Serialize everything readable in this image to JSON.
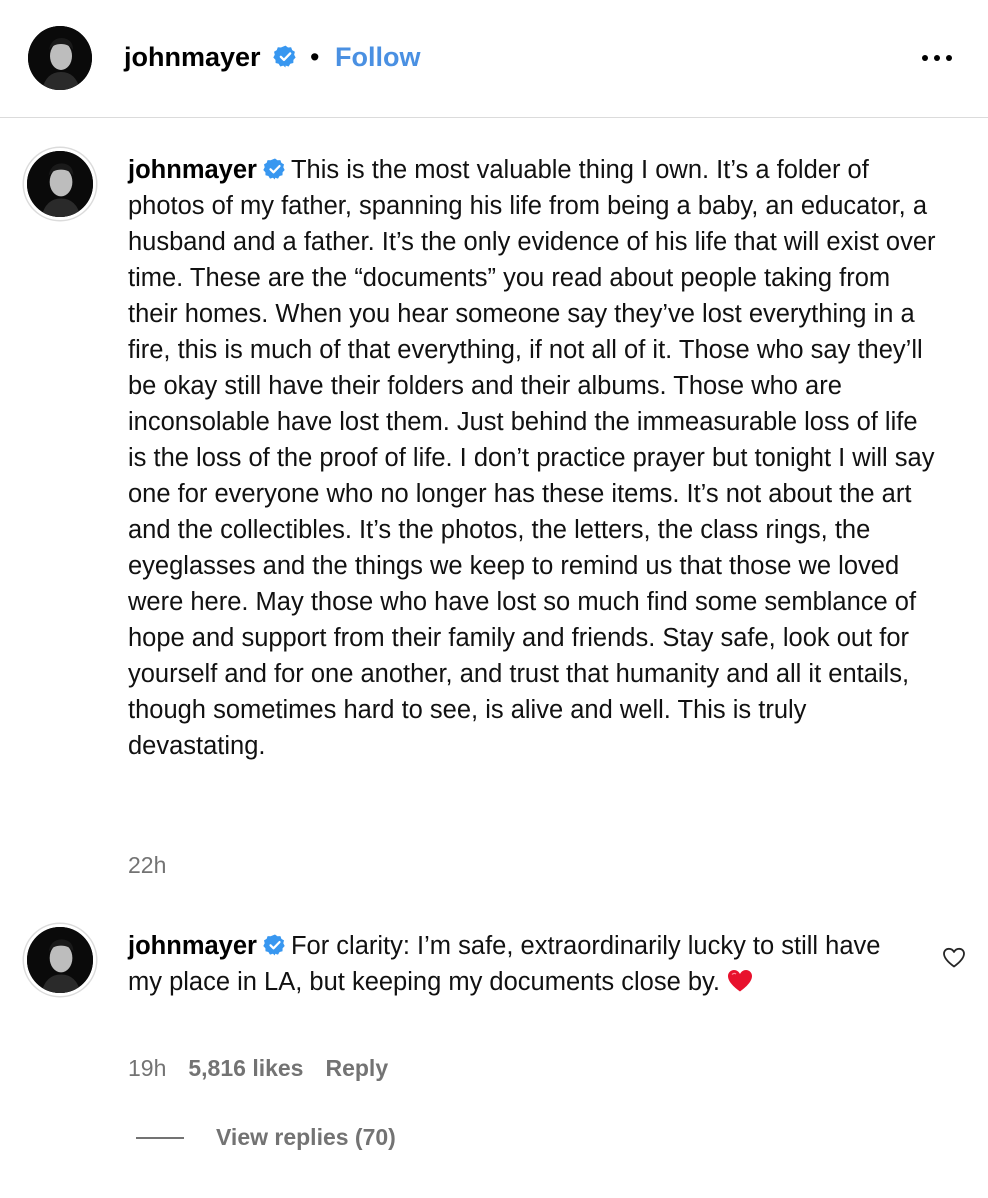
{
  "header": {
    "username": "johnmayer",
    "separator": "•",
    "follow_label": "Follow",
    "more_icon": "more-horizontal-icon"
  },
  "caption": {
    "username": "johnmayer",
    "text": "This is the most valuable thing I own. It’s a folder of photos of my father, spanning his life from being a baby, an educator, a husband and a father. It’s the only evidence of his life that will exist over time. These are the “documents” you read about people taking from their homes. When you hear someone say they’ve lost everything in a fire, this is much of that everything, if not all of it. Those who say they’ll be okay still have their folders and their albums. Those who are inconsolable have lost them. Just behind the immeasurable loss of life is the loss of the proof of life. I don’t practice prayer but tonight I will say one for everyone who no longer has these items. It’s not about the art and the collectibles. It’s the photos, the letters, the class rings, the eyeglasses and the things we keep to remind us that those we loved were here. May those who have lost so much find some semblance of hope and support from their family and friends. Stay safe, look out for yourself and for one another, and trust that humanity and all it entails, though sometimes hard to see, is alive and well. This is truly devastating.",
    "time": "22h"
  },
  "comment": {
    "username": "johnmayer",
    "text": "For clarity: I’m safe, extraordinarily lucky to still have my place in LA, but keeping my documents close by.",
    "emoji": "red-heart-emoji",
    "time": "19h",
    "likes": "5,816 likes",
    "reply_label": "Reply"
  },
  "replies": {
    "label": "View replies (70)"
  },
  "colors": {
    "accent": "#4a90e2",
    "verified": "#3897f0",
    "muted": "#737373",
    "divider": "#dbdbdb",
    "heart": "#e8112d"
  }
}
